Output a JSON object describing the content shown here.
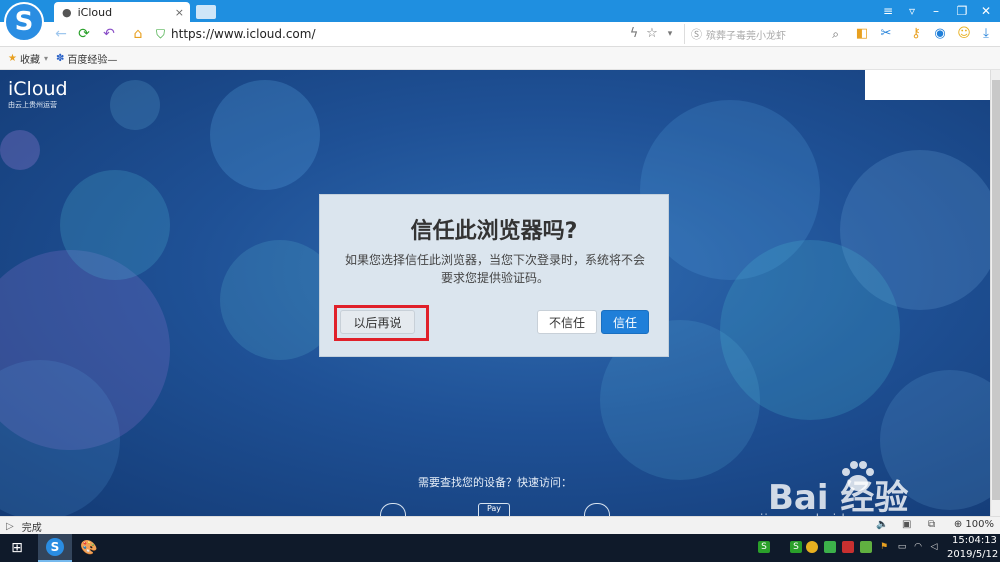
{
  "browser": {
    "tab_title": "iCloud",
    "tab_close": "×",
    "url": "https://www.icloud.com/",
    "search_placeholder": "殡葬子毒莞小龙虾",
    "logo_letter": "S"
  },
  "bookmarks": [
    {
      "label": "收藏"
    },
    {
      "label": "百度经验—"
    }
  ],
  "page": {
    "brand": "iCloud",
    "brand_sub": "由云上贵州运营",
    "find_device_text": "需要查找您的设备？快速访问：",
    "services": [
      "",
      "Pay",
      ""
    ]
  },
  "dialog": {
    "title": "信任此浏览器吗?",
    "body": "如果您选择信任此浏览器，当您下次登录时，系统将不会要求您提供验证码。",
    "btn_later": "以后再说",
    "btn_distrust": "不信任",
    "btn_trust": "信任",
    "highlight_color": "#e0202a",
    "trust_color": "#1f7fd9"
  },
  "watermark": {
    "main": "Bai  经验",
    "sub": "jingyan.baidu.com"
  },
  "status": {
    "text": "完成",
    "zoom": "100%"
  },
  "taskbar": {
    "time": "15:04:13",
    "date": "2019/5/12"
  }
}
